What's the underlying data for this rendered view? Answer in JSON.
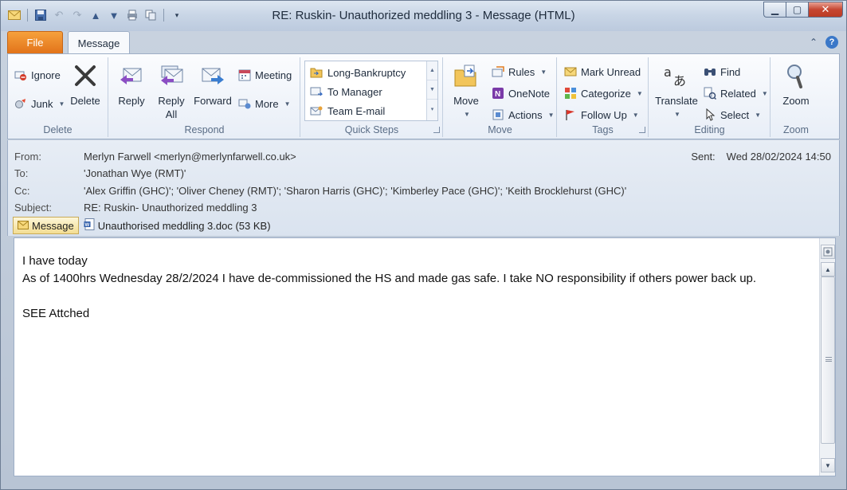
{
  "window": {
    "title": "RE: Ruskin- Unauthorized meddling 3  -  Message (HTML)"
  },
  "qat": [
    "mail-icon",
    "save-icon",
    "undo-icon",
    "redo-icon",
    "up-icon",
    "down-icon",
    "print-icon",
    "copy-icon",
    "customize-icon"
  ],
  "tabs": {
    "file": "File",
    "message": "Message"
  },
  "ribbon": {
    "delete_group": {
      "label": "Delete",
      "ignore": "Ignore",
      "junk": "Junk",
      "delete": "Delete"
    },
    "respond_group": {
      "label": "Respond",
      "reply": "Reply",
      "reply_all_1": "Reply",
      "reply_all_2": "All",
      "forward": "Forward",
      "meeting": "Meeting",
      "more": "More"
    },
    "quicksteps_group": {
      "label": "Quick Steps",
      "items": [
        "Long-Bankruptcy",
        "To Manager",
        "Team E-mail"
      ]
    },
    "move_group": {
      "label": "Move",
      "move": "Move",
      "rules": "Rules",
      "onenote": "OneNote",
      "actions": "Actions"
    },
    "tags_group": {
      "label": "Tags",
      "mark_unread": "Mark Unread",
      "categorize": "Categorize",
      "follow_up": "Follow Up"
    },
    "editing_group": {
      "label": "Editing",
      "translate": "Translate",
      "find": "Find",
      "related": "Related",
      "select": "Select"
    },
    "zoom_group": {
      "label": "Zoom",
      "zoom": "Zoom"
    }
  },
  "header": {
    "from_label": "From:",
    "from": "Merlyn Farwell <merlyn@merlynfarwell.co.uk>",
    "to_label": "To:",
    "to": "'Jonathan Wye (RMT)'",
    "cc_label": "Cc:",
    "cc": "'Alex Griffin (GHC)'; 'Oliver Cheney (RMT)'; 'Sharon Harris (GHC)'; 'Kimberley Pace (GHC)'; 'Keith Brocklehurst (GHC)'",
    "subject_label": "Subject:",
    "subject": "RE: Ruskin- Unauthorized meddling 3",
    "sent_label": "Sent:",
    "sent": "Wed 28/02/2024 14:50"
  },
  "attachments": {
    "message_tab": "Message",
    "file": "Unauthorised meddling 3.doc (53 KB)"
  },
  "body": {
    "line1": "I have today",
    "line2": "As of 1400hrs Wednesday 28/2/2024 I have de-commissioned the HS and made gas safe. I take NO responsibility if others power back up.",
    "line3": "SEE Attched"
  }
}
